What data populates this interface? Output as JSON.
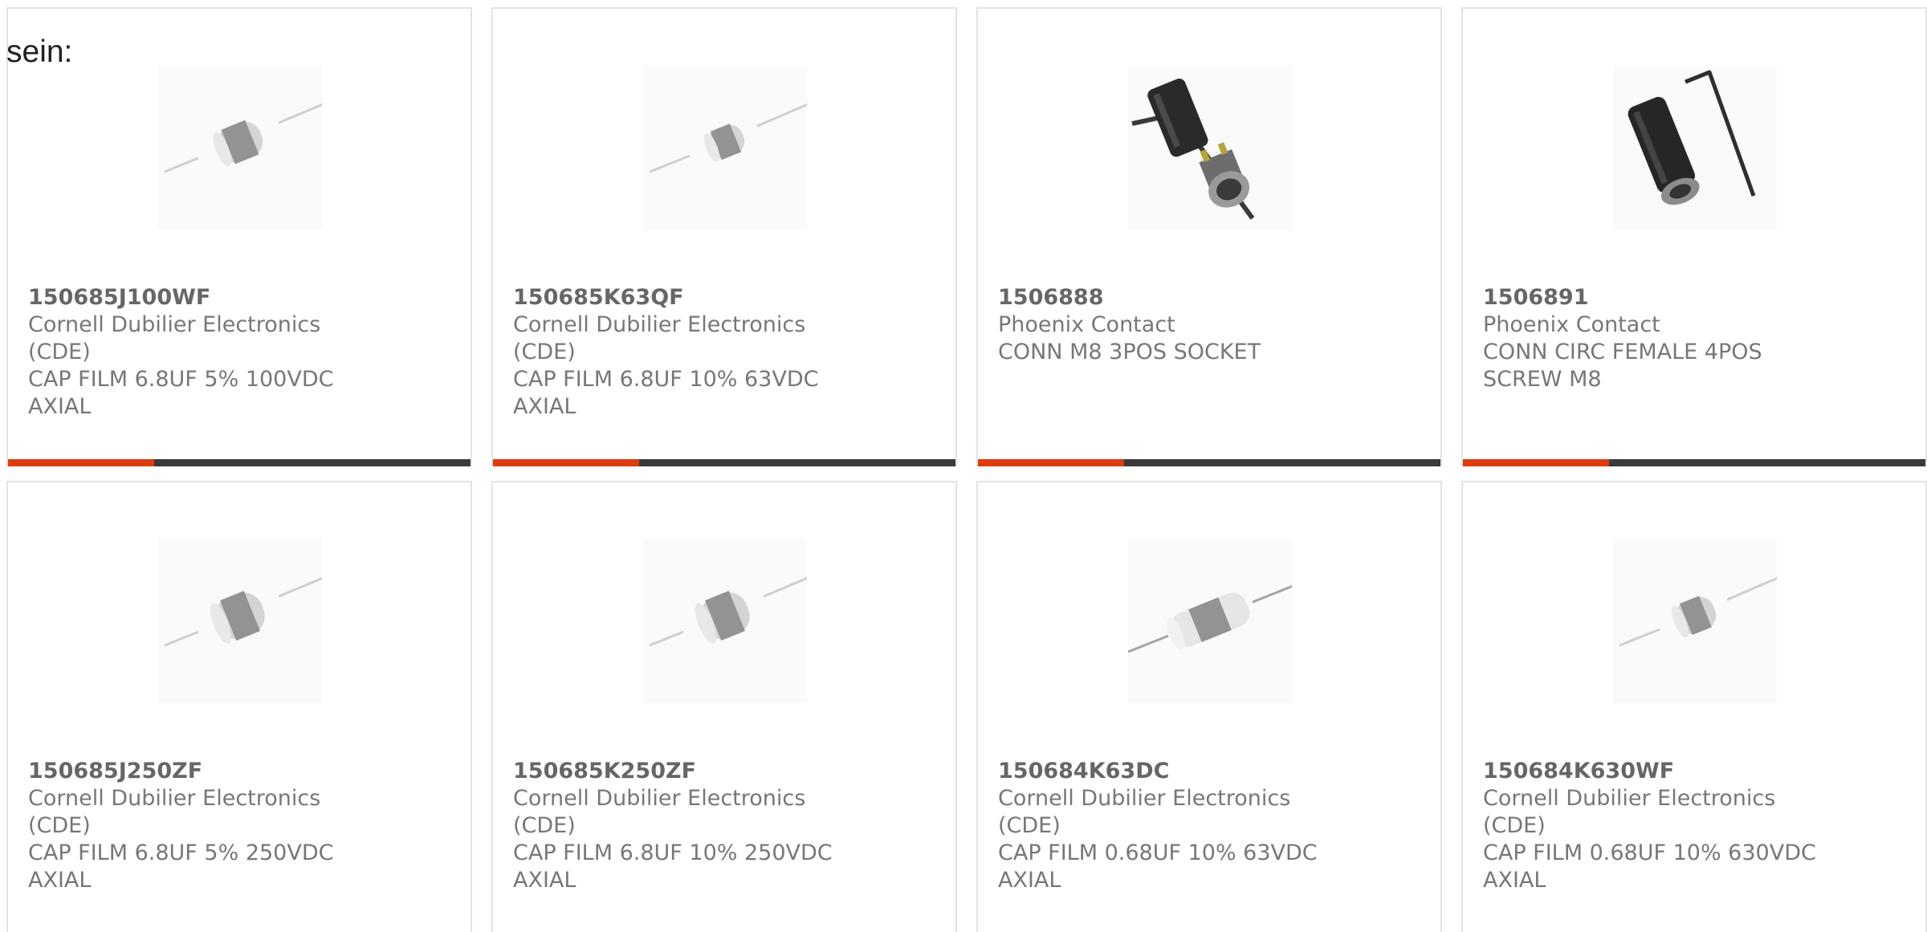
{
  "intro_text": "sein:",
  "colors": {
    "accent": "#dd3c10",
    "bar": "#3a3a3a",
    "border": "#e3e3e3",
    "text": "#666666"
  },
  "products": [
    {
      "part_number": "150685J100WF",
      "manufacturer": "Cornell Dubilier Electronics (CDE)",
      "description": "CAP FILM 6.8UF 5% 100VDC AXIAL",
      "image_icon": "axial-capacitor-icon"
    },
    {
      "part_number": "150685K63QF",
      "manufacturer": "Cornell Dubilier Electronics (CDE)",
      "description": "CAP FILM 6.8UF 10% 63VDC AXIAL",
      "image_icon": "axial-capacitor-icon"
    },
    {
      "part_number": "1506888",
      "manufacturer": "Phoenix Contact",
      "description": "CONN M8 3POS SOCKET",
      "image_icon": "m8-connector-icon"
    },
    {
      "part_number": "1506891",
      "manufacturer": "Phoenix Contact",
      "description": "CONN CIRC FEMALE 4POS SCREW M8",
      "image_icon": "circular-connector-icon"
    },
    {
      "part_number": "150685J250ZF",
      "manufacturer": "Cornell Dubilier Electronics (CDE)",
      "description": "CAP FILM 6.8UF 5% 250VDC AXIAL",
      "image_icon": "axial-capacitor-icon"
    },
    {
      "part_number": "150685K250ZF",
      "manufacturer": "Cornell Dubilier Electronics (CDE)",
      "description": "CAP FILM 6.8UF 10% 250VDC AXIAL",
      "image_icon": "axial-capacitor-icon"
    },
    {
      "part_number": "150684K63DC",
      "manufacturer": "Cornell Dubilier Electronics (CDE)",
      "description": "CAP FILM 0.68UF 10% 63VDC AXIAL",
      "image_icon": "axial-capacitor-icon"
    },
    {
      "part_number": "150684K630WF",
      "manufacturer": "Cornell Dubilier Electronics (CDE)",
      "description": "CAP FILM 0.68UF 10% 630VDC AXIAL",
      "image_icon": "axial-capacitor-icon"
    }
  ]
}
